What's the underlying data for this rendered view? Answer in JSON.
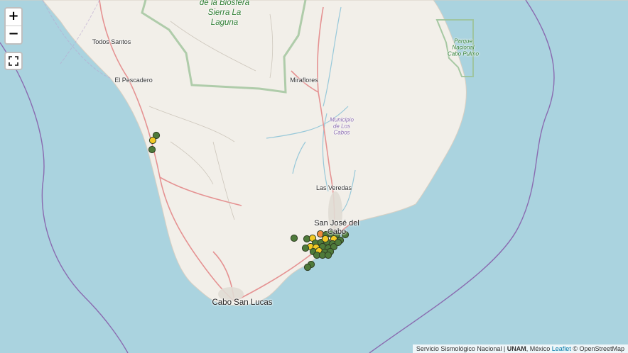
{
  "map": {
    "labels": {
      "reserve": [
        "de la Biosfera",
        "Sierra La",
        "Laguna"
      ],
      "todos_santos": "Todos Santos",
      "el_pescadero": "El Pescadero",
      "miraflores": "Miraflores",
      "municipio": [
        "Municipio",
        "de Los",
        "Cabos"
      ],
      "park": [
        "Parque",
        "Nacional",
        "Cabo Pulmo"
      ],
      "las_veredas": "Las Veredas",
      "san_jose": [
        "San José del",
        "Cabo"
      ],
      "cabo_san_lucas": "Cabo San Lucas"
    },
    "marker_colors": {
      "green": "#4e7a3a",
      "yellow": "#f2c925",
      "orange": "#f08a3c",
      "stroke": "#2f3e22"
    },
    "colors": {
      "sea": "#aad3df",
      "land": "#f2efe9",
      "reserve_border": "#9dc39a",
      "road": "#e59292",
      "stream": "#8ec4d8",
      "boundary": "#8a6bb0"
    }
  },
  "controls": {
    "zoom_in": "+",
    "zoom_out": "−",
    "fullscreen_icon": "fullscreen-icon"
  },
  "attribution": {
    "source": "Servicio Sismológico Nacional",
    "sep": " | ",
    "org": "UNAM",
    "country": ", México",
    "leaflet": "Leaflet",
    "osm": "© OpenStreetMap"
  }
}
